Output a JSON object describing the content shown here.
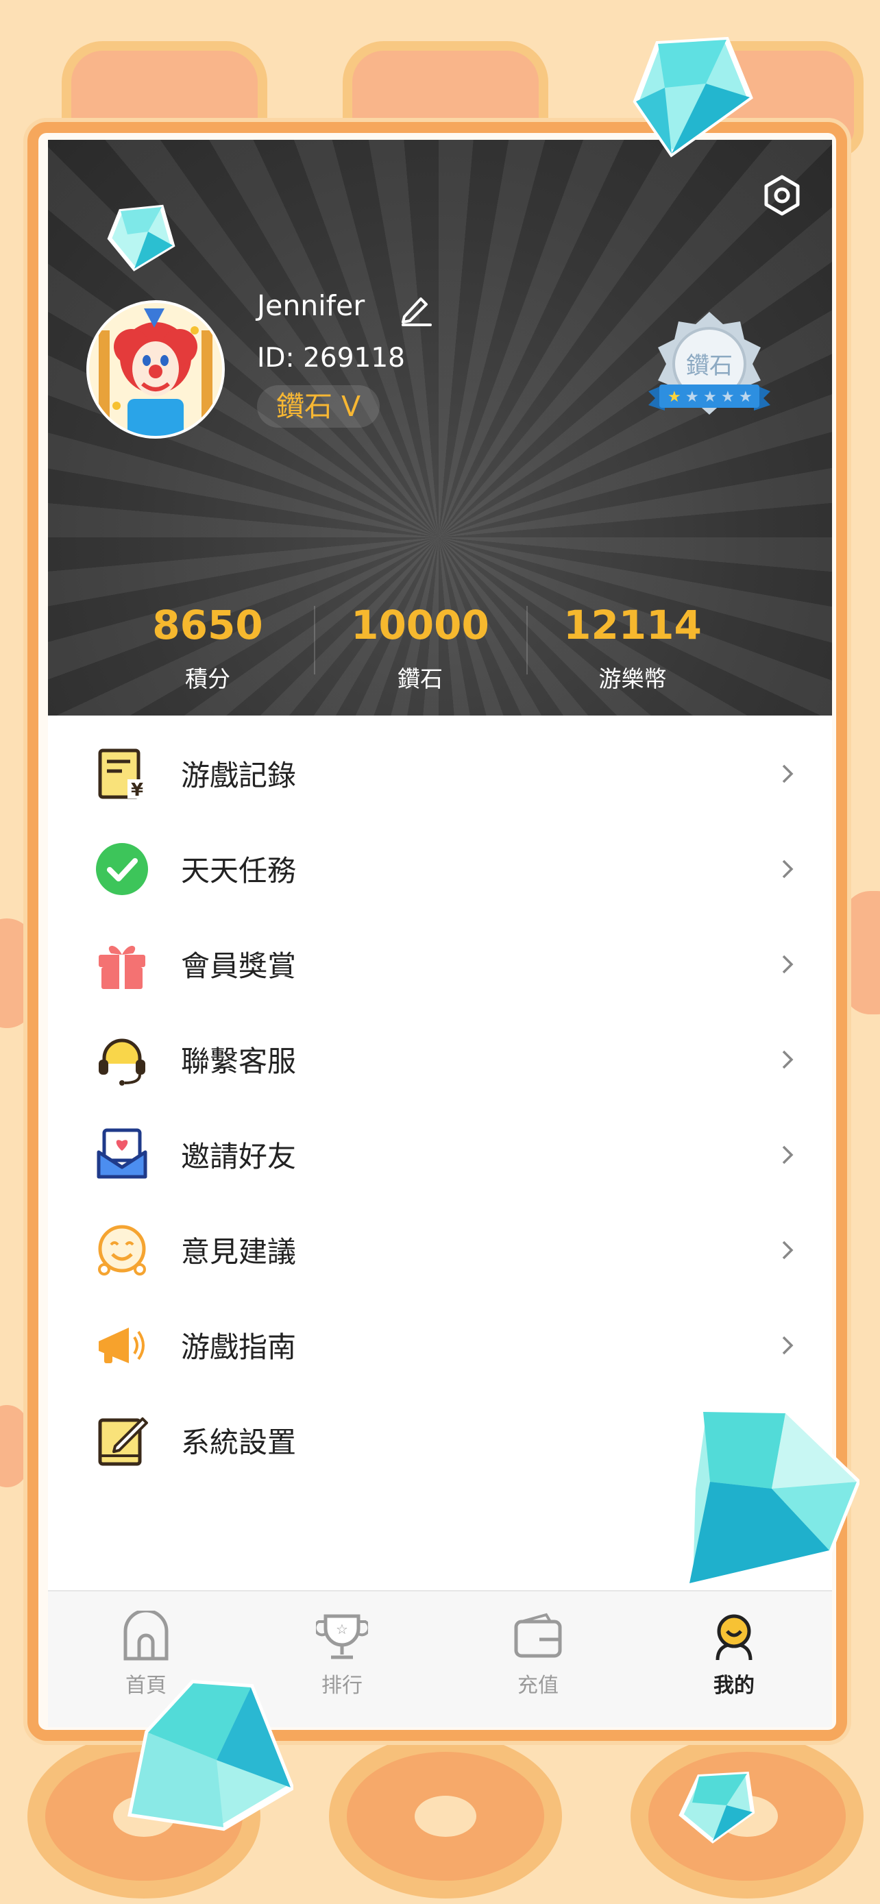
{
  "profile": {
    "name": "Jennifer",
    "id_text": "ID: 269118",
    "level": "鑽石 V",
    "medal_text": "鑽石"
  },
  "stats": [
    {
      "value": "8650",
      "label": "積分"
    },
    {
      "value": "10000",
      "label": "鑽石"
    },
    {
      "value": "12114",
      "label": "游樂幣"
    }
  ],
  "menu": [
    {
      "label": "游戲記錄",
      "icon": "game-record-icon"
    },
    {
      "label": "天天任務",
      "icon": "daily-task-check-icon"
    },
    {
      "label": "會員獎賞",
      "icon": "gift-icon"
    },
    {
      "label": "聯繫客服",
      "icon": "headset-icon"
    },
    {
      "label": "邀請好友",
      "icon": "invite-mail-icon"
    },
    {
      "label": "意見建議",
      "icon": "smiley-icon"
    },
    {
      "label": "游戲指南",
      "icon": "megaphone-icon"
    },
    {
      "label": "系統設置",
      "icon": "settings-note-icon"
    }
  ],
  "tabs": [
    {
      "label": "首頁",
      "icon": "home-icon"
    },
    {
      "label": "排行",
      "icon": "ranking-trophy-icon"
    },
    {
      "label": "充值",
      "icon": "wallet-icon"
    },
    {
      "label": "我的",
      "icon": "profile-icon"
    }
  ],
  "colors": {
    "accent_gold": "#f6b82e",
    "frame_orange": "#f6a75c",
    "background": "#fde0b5"
  }
}
